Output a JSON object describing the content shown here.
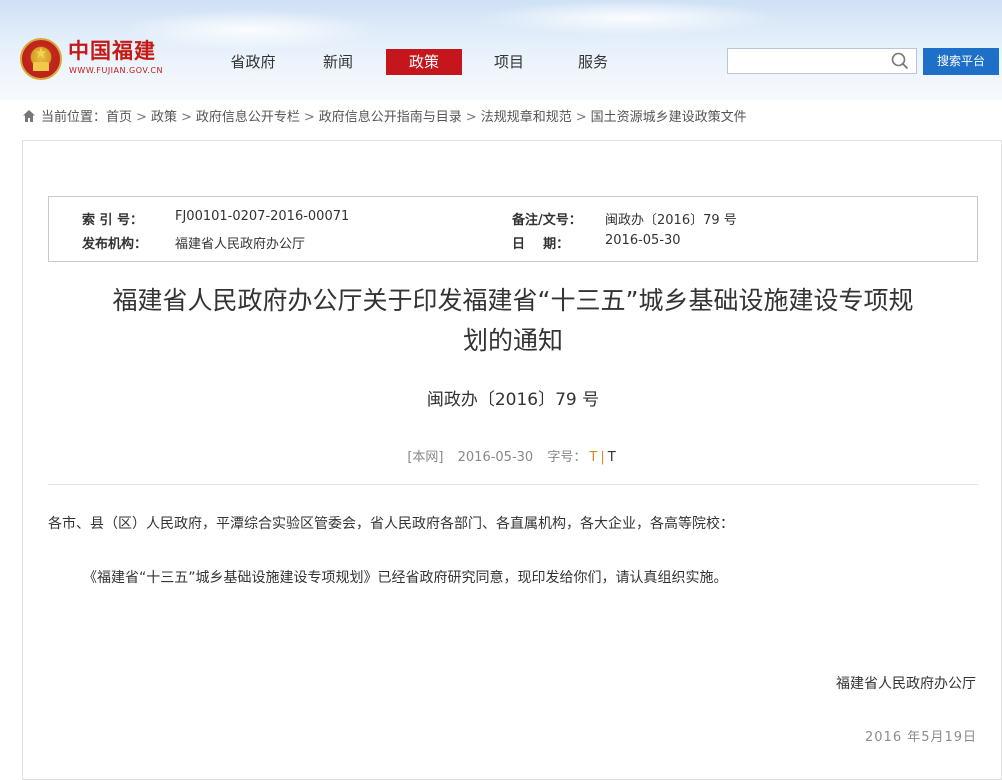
{
  "site": {
    "name": "中国福建",
    "url": "WWW.FUJIAN.GOV.CN"
  },
  "nav": {
    "items": [
      {
        "label": "省政府",
        "active": false
      },
      {
        "label": "新闻",
        "active": false
      },
      {
        "label": "政策",
        "active": true
      },
      {
        "label": "项目",
        "active": false
      },
      {
        "label": "服务",
        "active": false
      }
    ]
  },
  "search": {
    "value": "",
    "button_label": "搜索平台"
  },
  "breadcrumb": {
    "prefix": "当前位置：",
    "items": [
      "首页",
      "政策",
      "政府信息公开专栏",
      "政府信息公开指南与目录",
      "法规规章和规范",
      "国土资源城乡建设政策文件"
    ],
    "separator": ">"
  },
  "meta": {
    "index_label": "索 引 号：",
    "index_value": "FJ00101-0207-2016-00071",
    "note_label": "备注/文号：",
    "note_value": "闽政办〔2016〕79 号",
    "publisher_label": "发布机构：",
    "publisher_value": "福建省人民政府办公厅",
    "date_label": "日    期：",
    "date_value": "2016-05-30"
  },
  "document": {
    "title_line1": "福建省人民政府办公厅关于印发福建省“十三五”城乡基础设施建设专项规",
    "title_line2": "划的通知",
    "number": "闽政办〔2016〕79 号",
    "source": "[本网]",
    "date": "2016-05-30",
    "font_size_label": "字号：",
    "font_large": "T",
    "font_sep": "|",
    "font_small": "T",
    "salutation": "各市、县（区）人民政府，平潭综合实验区管委会，省人民政府各部门、各直属机构，各大企业，各高等院校：",
    "paragraph1": "《福建省“十三五”城乡基础设施建设专项规划》已经省政府研究同意，现印发给你们，请认真组织实施。",
    "issuer": "福建省人民政府办公厅",
    "footer_date": "2016 年5月19日"
  },
  "colors": {
    "brand_red": "#c4161c",
    "search_blue": "#1e6fc8",
    "accent_orange": "#e08a1e"
  }
}
